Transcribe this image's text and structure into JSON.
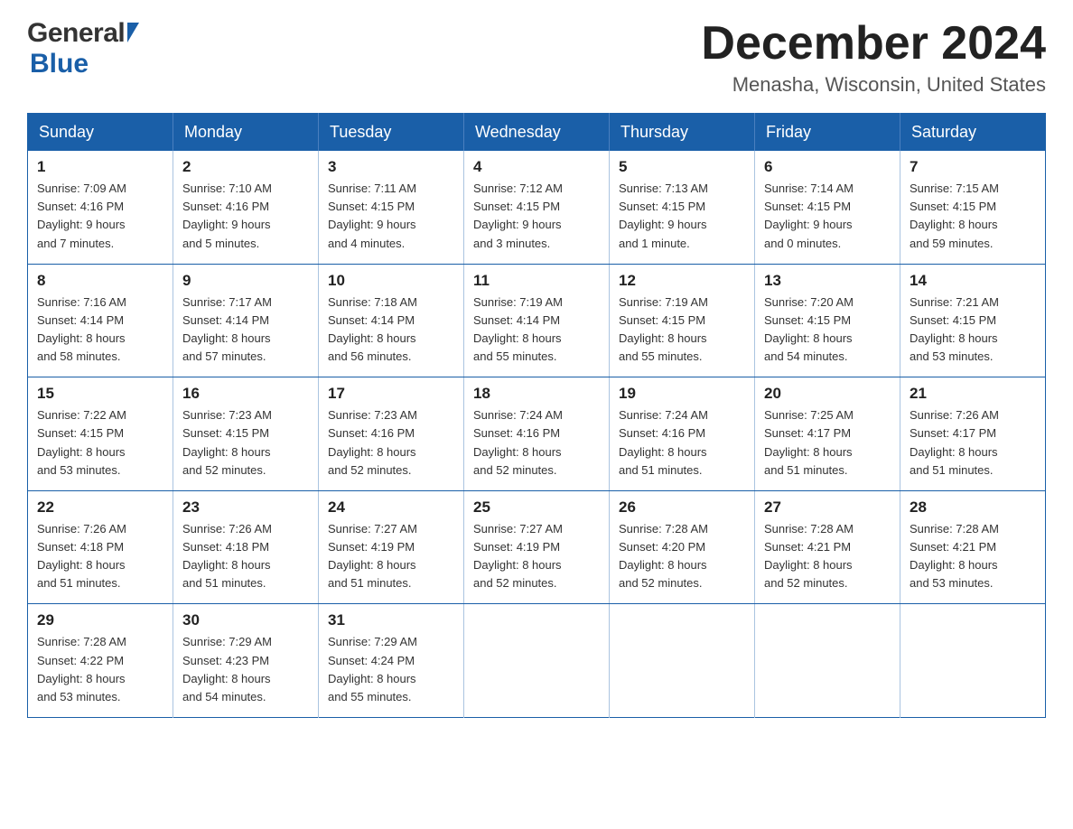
{
  "header": {
    "logo": {
      "general": "General",
      "blue": "Blue",
      "arrow": "▶"
    },
    "title": "December 2024",
    "location": "Menasha, Wisconsin, United States"
  },
  "calendar": {
    "days_of_week": [
      "Sunday",
      "Monday",
      "Tuesday",
      "Wednesday",
      "Thursday",
      "Friday",
      "Saturday"
    ],
    "weeks": [
      [
        {
          "day": "1",
          "sunrise": "7:09 AM",
          "sunset": "4:16 PM",
          "daylight": "9 hours and 7 minutes."
        },
        {
          "day": "2",
          "sunrise": "7:10 AM",
          "sunset": "4:16 PM",
          "daylight": "9 hours and 5 minutes."
        },
        {
          "day": "3",
          "sunrise": "7:11 AM",
          "sunset": "4:15 PM",
          "daylight": "9 hours and 4 minutes."
        },
        {
          "day": "4",
          "sunrise": "7:12 AM",
          "sunset": "4:15 PM",
          "daylight": "9 hours and 3 minutes."
        },
        {
          "day": "5",
          "sunrise": "7:13 AM",
          "sunset": "4:15 PM",
          "daylight": "9 hours and 1 minute."
        },
        {
          "day": "6",
          "sunrise": "7:14 AM",
          "sunset": "4:15 PM",
          "daylight": "9 hours and 0 minutes."
        },
        {
          "day": "7",
          "sunrise": "7:15 AM",
          "sunset": "4:15 PM",
          "daylight": "8 hours and 59 minutes."
        }
      ],
      [
        {
          "day": "8",
          "sunrise": "7:16 AM",
          "sunset": "4:14 PM",
          "daylight": "8 hours and 58 minutes."
        },
        {
          "day": "9",
          "sunrise": "7:17 AM",
          "sunset": "4:14 PM",
          "daylight": "8 hours and 57 minutes."
        },
        {
          "day": "10",
          "sunrise": "7:18 AM",
          "sunset": "4:14 PM",
          "daylight": "8 hours and 56 minutes."
        },
        {
          "day": "11",
          "sunrise": "7:19 AM",
          "sunset": "4:14 PM",
          "daylight": "8 hours and 55 minutes."
        },
        {
          "day": "12",
          "sunrise": "7:19 AM",
          "sunset": "4:15 PM",
          "daylight": "8 hours and 55 minutes."
        },
        {
          "day": "13",
          "sunrise": "7:20 AM",
          "sunset": "4:15 PM",
          "daylight": "8 hours and 54 minutes."
        },
        {
          "day": "14",
          "sunrise": "7:21 AM",
          "sunset": "4:15 PM",
          "daylight": "8 hours and 53 minutes."
        }
      ],
      [
        {
          "day": "15",
          "sunrise": "7:22 AM",
          "sunset": "4:15 PM",
          "daylight": "8 hours and 53 minutes."
        },
        {
          "day": "16",
          "sunrise": "7:23 AM",
          "sunset": "4:15 PM",
          "daylight": "8 hours and 52 minutes."
        },
        {
          "day": "17",
          "sunrise": "7:23 AM",
          "sunset": "4:16 PM",
          "daylight": "8 hours and 52 minutes."
        },
        {
          "day": "18",
          "sunrise": "7:24 AM",
          "sunset": "4:16 PM",
          "daylight": "8 hours and 52 minutes."
        },
        {
          "day": "19",
          "sunrise": "7:24 AM",
          "sunset": "4:16 PM",
          "daylight": "8 hours and 51 minutes."
        },
        {
          "day": "20",
          "sunrise": "7:25 AM",
          "sunset": "4:17 PM",
          "daylight": "8 hours and 51 minutes."
        },
        {
          "day": "21",
          "sunrise": "7:26 AM",
          "sunset": "4:17 PM",
          "daylight": "8 hours and 51 minutes."
        }
      ],
      [
        {
          "day": "22",
          "sunrise": "7:26 AM",
          "sunset": "4:18 PM",
          "daylight": "8 hours and 51 minutes."
        },
        {
          "day": "23",
          "sunrise": "7:26 AM",
          "sunset": "4:18 PM",
          "daylight": "8 hours and 51 minutes."
        },
        {
          "day": "24",
          "sunrise": "7:27 AM",
          "sunset": "4:19 PM",
          "daylight": "8 hours and 51 minutes."
        },
        {
          "day": "25",
          "sunrise": "7:27 AM",
          "sunset": "4:19 PM",
          "daylight": "8 hours and 52 minutes."
        },
        {
          "day": "26",
          "sunrise": "7:28 AM",
          "sunset": "4:20 PM",
          "daylight": "8 hours and 52 minutes."
        },
        {
          "day": "27",
          "sunrise": "7:28 AM",
          "sunset": "4:21 PM",
          "daylight": "8 hours and 52 minutes."
        },
        {
          "day": "28",
          "sunrise": "7:28 AM",
          "sunset": "4:21 PM",
          "daylight": "8 hours and 53 minutes."
        }
      ],
      [
        {
          "day": "29",
          "sunrise": "7:28 AM",
          "sunset": "4:22 PM",
          "daylight": "8 hours and 53 minutes."
        },
        {
          "day": "30",
          "sunrise": "7:29 AM",
          "sunset": "4:23 PM",
          "daylight": "8 hours and 54 minutes."
        },
        {
          "day": "31",
          "sunrise": "7:29 AM",
          "sunset": "4:24 PM",
          "daylight": "8 hours and 55 minutes."
        },
        null,
        null,
        null,
        null
      ]
    ],
    "labels": {
      "sunrise": "Sunrise:",
      "sunset": "Sunset:",
      "daylight": "Daylight:"
    }
  }
}
